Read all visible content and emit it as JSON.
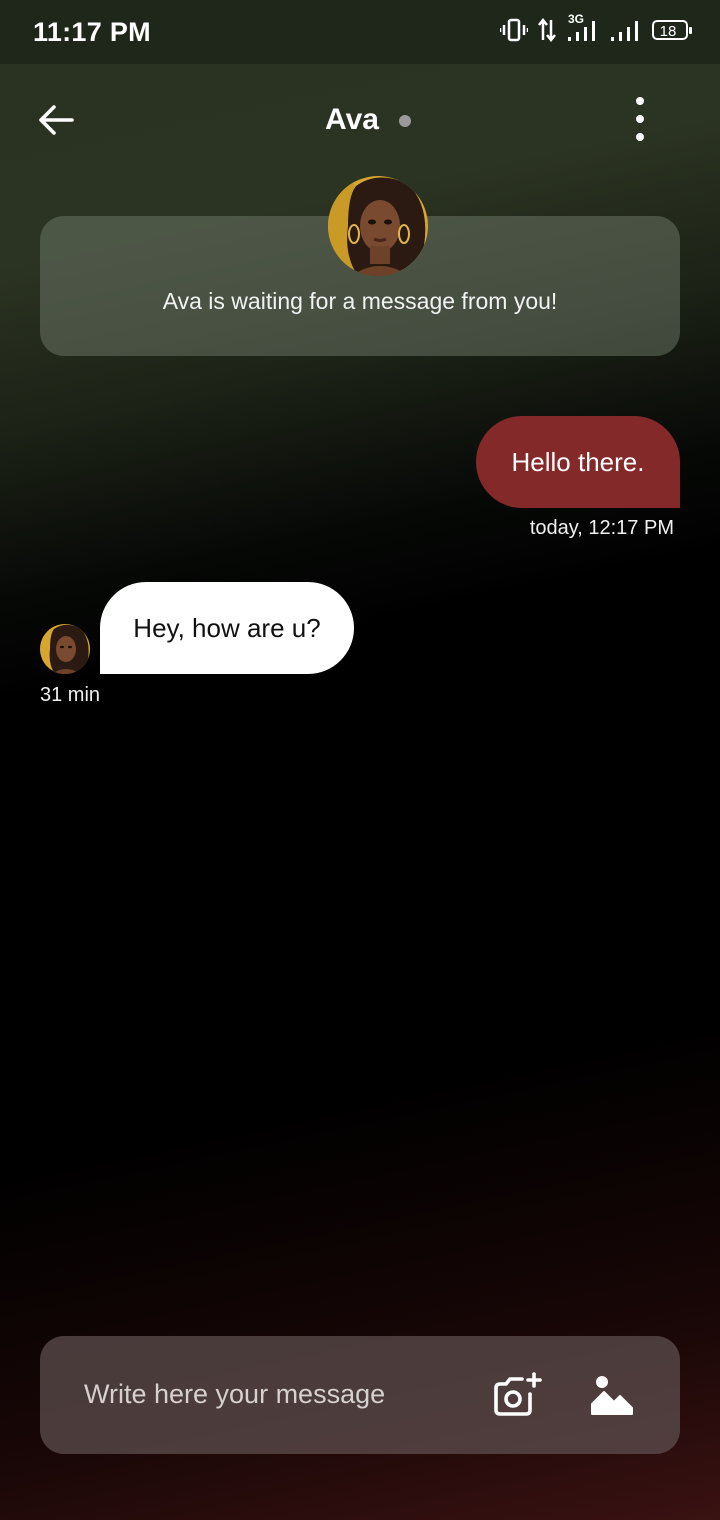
{
  "status_bar": {
    "time": "11:17 PM",
    "network_label": "3G",
    "battery_level": "18"
  },
  "header": {
    "contact_name": "Ava",
    "back_icon": "arrow-left-icon",
    "menu_icon": "more-vertical-icon"
  },
  "intro_card": {
    "text": "Ava is waiting for a message from you!"
  },
  "messages": [
    {
      "direction": "outgoing",
      "text": "Hello there.",
      "timestamp": "today, 12:17 PM",
      "color": "#84292a"
    },
    {
      "direction": "incoming",
      "text": "Hey, how are u?",
      "timestamp": "31 min",
      "color": "#ffffff"
    }
  ],
  "composer": {
    "placeholder": "Write here your message",
    "camera_icon": "camera-plus-icon",
    "gallery_icon": "image-icon"
  }
}
